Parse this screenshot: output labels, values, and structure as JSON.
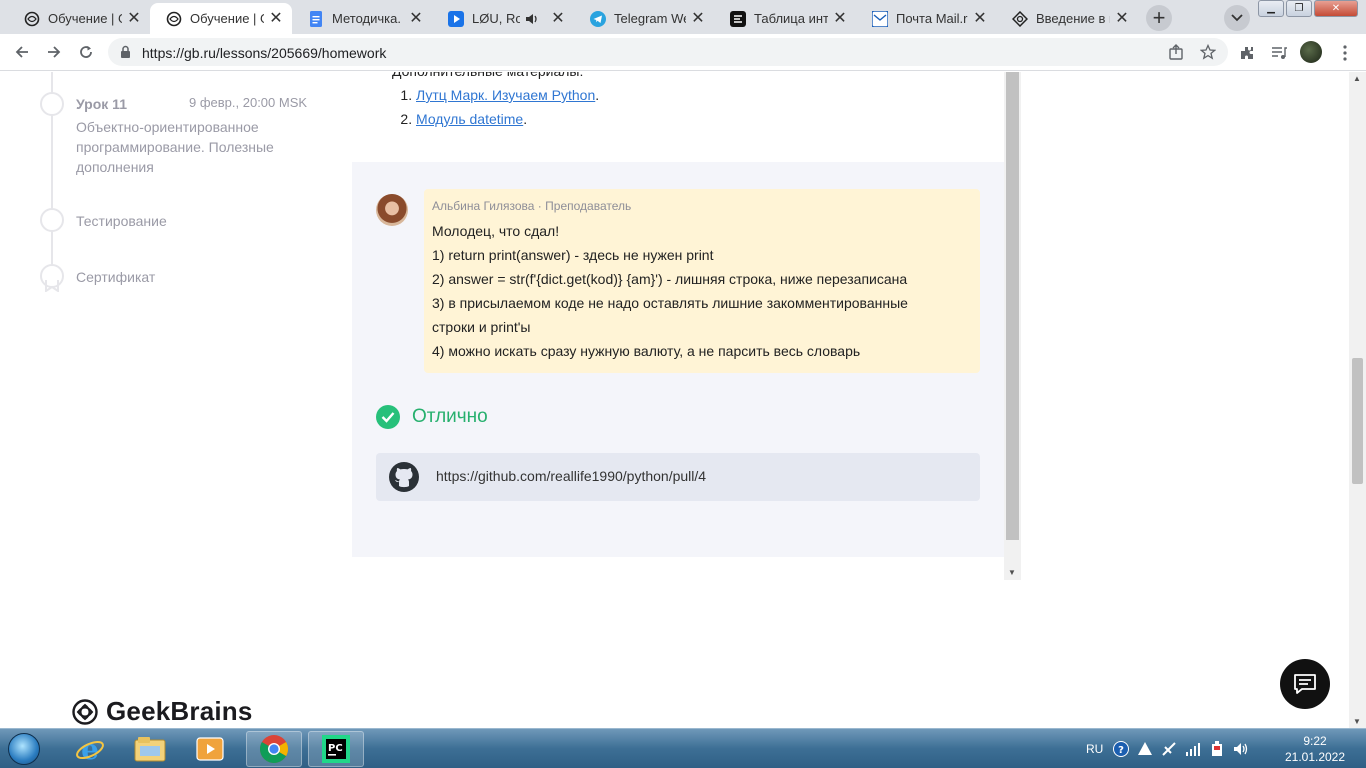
{
  "browser": {
    "tabs": [
      {
        "title": "Обучение | Ge",
        "icon": "geekbrains-icon",
        "active": false
      },
      {
        "title": "Обучение | Ge",
        "icon": "geekbrains-icon",
        "active": true
      },
      {
        "title": "Методичка. Ур",
        "icon": "google-docs-icon",
        "active": false
      },
      {
        "title": "LØU, Robi",
        "icon": "youtube-music-icon",
        "active": false
      },
      {
        "title": "Telegram Web",
        "icon": "telegram-icon",
        "active": false
      },
      {
        "title": "Таблица интег",
        "icon": "table-app-icon",
        "active": false
      },
      {
        "title": "Почта Mail.ru",
        "icon": "mail-icon",
        "active": false
      },
      {
        "title": "Введение в ге",
        "icon": "site-icon",
        "active": false
      }
    ],
    "url": "https://gb.ru/lessons/205669/homework"
  },
  "sidebar": {
    "lesson": {
      "title": "Урок 11",
      "date": "9 февр., 20:00 MSK",
      "description": "Объектно-ориентированное программирование. Полезные дополнения"
    },
    "items": [
      {
        "label": "Тестирование"
      },
      {
        "label": "Сертификат"
      }
    ]
  },
  "materials": {
    "heading": "Дополнительные материалы:",
    "links": [
      {
        "text": "Лутц Марк. Изучаем Python",
        "suffix": "."
      },
      {
        "text": "Модуль datetime",
        "suffix": "."
      }
    ]
  },
  "review": {
    "author": "Альбина Гилязова",
    "role": "Преподаватель",
    "separator": "·",
    "lines": [
      "Молодец, что сдал!",
      "1) return print(answer) - здесь не нужен print",
      "2) answer = str(f'{dict.get(kod)} {am}') - лишняя строка, ниже перезаписана",
      "3) в присылаемом коде не надо оставлять лишние закомментированные",
      "строки и print'ы",
      "4) можно искать сразу нужную валюту, а не парсить весь словарь"
    ]
  },
  "status": {
    "label": "Отлично",
    "color": "#27b06e"
  },
  "submission": {
    "url": "https://github.com/reallife1990/python/pull/4"
  },
  "footer": {
    "logo": "GeekBrains"
  },
  "taskbar": {
    "language": "RU",
    "time": "9:22",
    "date": "21.01.2022"
  }
}
